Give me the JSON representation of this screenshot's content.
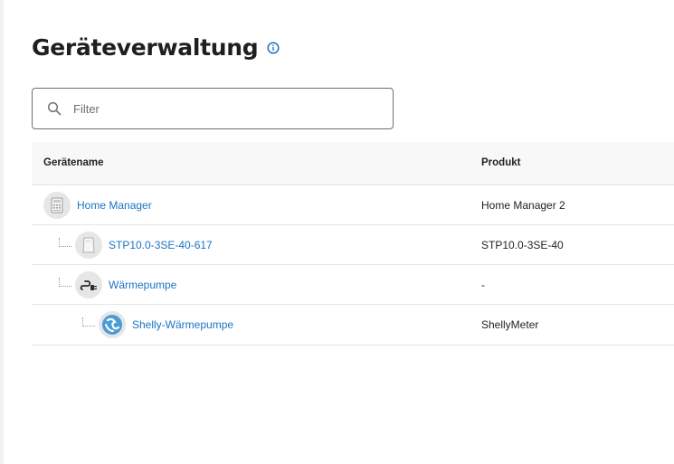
{
  "page": {
    "title": "Geräteverwaltung",
    "info_icon": "info-circle-icon",
    "accent_color": "#1a74c4"
  },
  "filter": {
    "placeholder": "Filter",
    "value": "",
    "icon": "search-icon"
  },
  "table": {
    "columns": [
      "Gerätename",
      "Produkt"
    ],
    "rows": [
      {
        "name": "Home Manager",
        "product": "Home Manager 2",
        "icon": "home-manager-icon",
        "level": 0
      },
      {
        "name": "STP10.0-3SE-40-617",
        "product": "STP10.0-3SE-40",
        "icon": "inverter-icon",
        "level": 1
      },
      {
        "name": "Wärmepumpe",
        "product": "-",
        "icon": "plug-icon",
        "level": 1
      },
      {
        "name": "Shelly-Wärmepumpe",
        "product": "ShellyMeter",
        "icon": "shelly-icon",
        "level": 2
      }
    ]
  }
}
